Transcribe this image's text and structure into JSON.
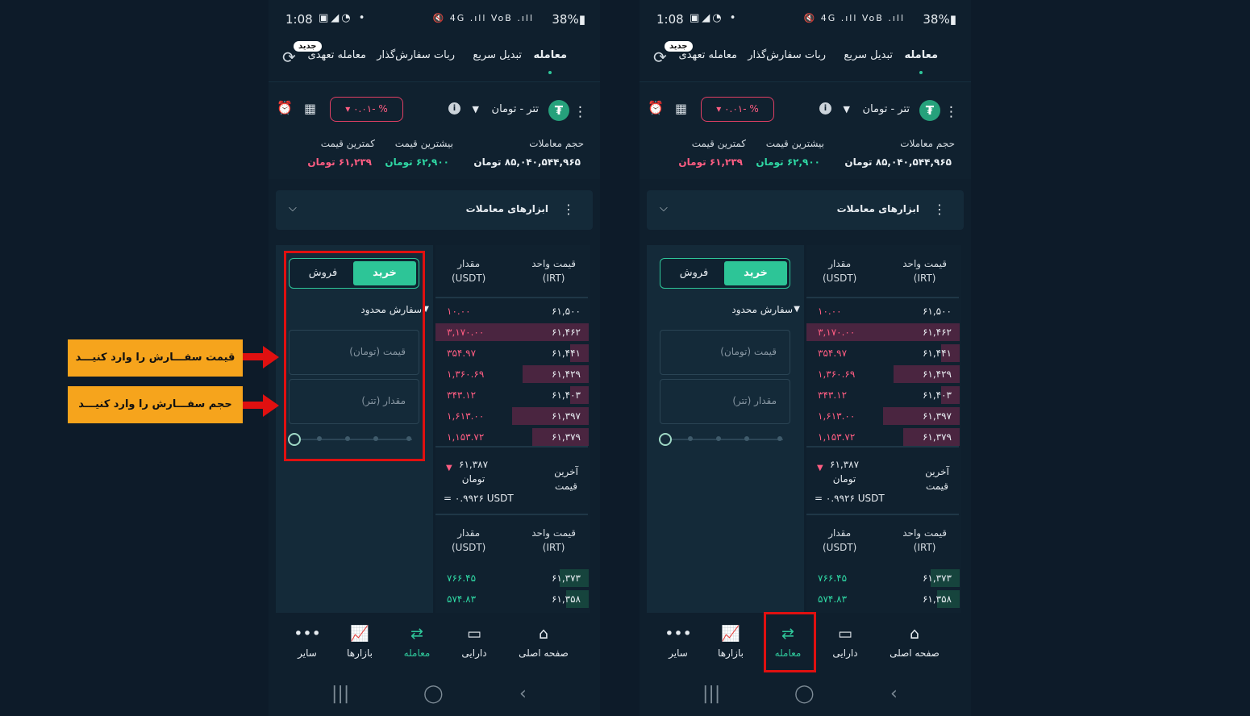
{
  "status_bar": {
    "time": "1:08",
    "left_icons": "▣◢◔ •",
    "right_icons": "🔇 4G .ıll VoB .ıll",
    "battery": "38%▮"
  },
  "tabs": {
    "trade": "معامله",
    "quick_swap": "تبدیل سریع",
    "order_bot": "ربات سفارش‌گذار",
    "commitment_trade": "معامله تعهدی",
    "new_badge": "جدید"
  },
  "market": {
    "pair": "تتر - تومان",
    "coin_symbol": "₮",
    "change": "% -۰.۰۱ ▾",
    "volume_label": "حجم معاملات",
    "volume_value": "۸۵,۰۴۰,۵۴۴,۹۶۵ تومان",
    "high_label": "بیشترین قیمت",
    "high_value": "۶۲,۹۰۰ تومان",
    "low_label": "کمترین قیمت",
    "low_value": "۶۱,۲۳۹ تومان"
  },
  "tools": {
    "label": "ابزارهای معاملات"
  },
  "order_form": {
    "buy": "خرید",
    "sell": "فروش",
    "order_type": "سفارش محدود",
    "price_placeholder": "قیمت (تومان)",
    "amount_placeholder": "مقدار (تتر)"
  },
  "order_book": {
    "price_header": [
      "قیمت واحد",
      "(IRT)"
    ],
    "amount_header": [
      "مقدار",
      "(USDT)"
    ],
    "asks": [
      {
        "price": "۶۱,۵۰۰",
        "amount": "۱۰.۰۰",
        "depth": 0.0
      },
      {
        "price": "۶۱,۴۶۲",
        "amount": "۳,۱۷۰.۰۰",
        "depth": 1.0
      },
      {
        "price": "۶۱,۴۴۱",
        "amount": "۳۵۴.۹۷",
        "depth": 0.12
      },
      {
        "price": "۶۱,۴۲۹",
        "amount": "۱,۳۶۰.۶۹",
        "depth": 0.43
      },
      {
        "price": "۶۱,۴۰۳",
        "amount": "۳۴۳.۱۲",
        "depth": 0.12
      },
      {
        "price": "۶۱,۳۹۷",
        "amount": "۱,۶۱۳.۰۰",
        "depth": 0.5
      },
      {
        "price": "۶۱,۳۷۹",
        "amount": "۱,۱۵۳.۷۲",
        "depth": 0.37
      }
    ],
    "last_price_label": [
      "آخرین",
      "قیمت"
    ],
    "last_price_value": [
      "۶۱,۳۸۷",
      "تومان"
    ],
    "last_price_usdt": "= ۰.۹۹۲۶ USDT",
    "bids": [
      {
        "price": "۶۱,۳۷۳",
        "amount": "۷۶۶.۴۵",
        "depth": 0.19
      },
      {
        "price": "۶۱,۳۵۸",
        "amount": "۵۷۴.۸۳",
        "depth": 0.15
      }
    ]
  },
  "nav": {
    "other": "سایر",
    "markets": "بازارها",
    "trade": "معامله",
    "assets": "دارایی",
    "home": "صفحه اصلی"
  },
  "annotations": {
    "price_callout": "قیمت سفـــارش را وارد کنیـــد",
    "amount_callout": "حجم سفـــارش را وارد کنیـــد",
    "highlight_color": "#e01010",
    "callout_color": "#f6a41c"
  },
  "colors": {
    "accent": "#2fc79a",
    "negative": "#ff5d82",
    "background": "#0f1f2d"
  }
}
